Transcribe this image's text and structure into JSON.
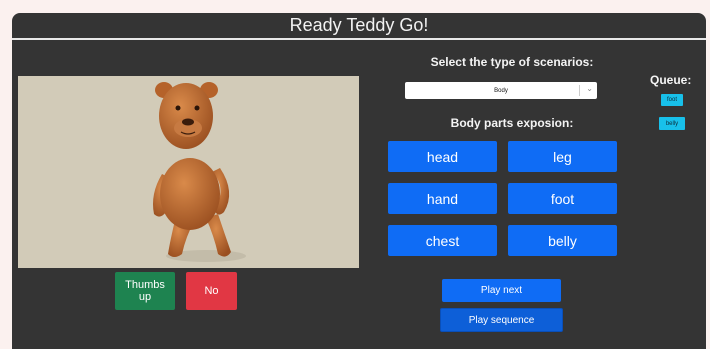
{
  "app": {
    "title": "Ready Teddy Go!"
  },
  "scene": {
    "bear_icon": "teddy-bear-3d-model"
  },
  "feedback": {
    "thumbs_up_label": "Thumbs up",
    "no_label": "No"
  },
  "scenario": {
    "heading": "Select the type of scenarios:",
    "selected": "Body"
  },
  "body_parts": {
    "heading": "Body parts exposion:",
    "items": [
      "head",
      "leg",
      "hand",
      "foot",
      "chest",
      "belly"
    ]
  },
  "queue": {
    "title": "Queue:",
    "items": [
      "foot",
      "belly"
    ]
  },
  "controls": {
    "play_next_label": "Play next",
    "play_sequence_label": "Play sequence"
  },
  "colors": {
    "primary": "#0f6cf5",
    "success": "#1e8350",
    "danger": "#e13744",
    "queue_item": "#18c0ea",
    "panel": "#343434"
  }
}
